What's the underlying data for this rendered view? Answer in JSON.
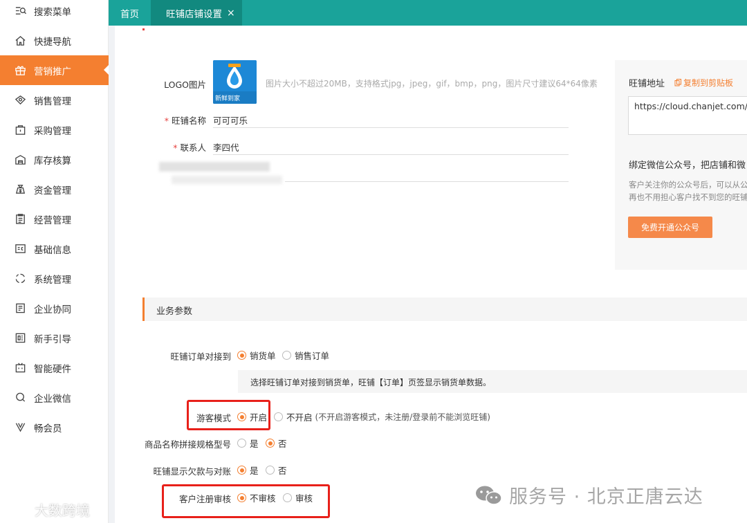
{
  "sidebar": {
    "items": [
      {
        "label": "搜索菜单",
        "icon": "search-menu-icon"
      },
      {
        "label": "快捷导航",
        "icon": "home-icon"
      },
      {
        "label": "营销推广",
        "icon": "gift-icon",
        "active": true
      },
      {
        "label": "销售管理",
        "icon": "sales-icon"
      },
      {
        "label": "采购管理",
        "icon": "bag-icon"
      },
      {
        "label": "库存核算",
        "icon": "warehouse-icon"
      },
      {
        "label": "资金管理",
        "icon": "money-bag-icon"
      },
      {
        "label": "经营管理",
        "icon": "clipboard-icon"
      },
      {
        "label": "基础信息",
        "icon": "id-card-icon"
      },
      {
        "label": "系统管理",
        "icon": "loading-circle-icon"
      },
      {
        "label": "企业协同",
        "icon": "document-icon"
      },
      {
        "label": "新手引导",
        "icon": "guide-icon"
      },
      {
        "label": "智能硬件",
        "icon": "device-icon"
      },
      {
        "label": "企业微信",
        "icon": "wechat-work-icon"
      },
      {
        "label": "畅会员",
        "icon": "v-icon"
      }
    ]
  },
  "tabs": [
    {
      "label": "首页",
      "active": false
    },
    {
      "label": "旺铺店铺设置",
      "active": true,
      "close": "×"
    }
  ],
  "form": {
    "logo_label": "LOGO图片",
    "logo_text": "新鲜到家",
    "logo_hint": "图片大小不超过20MB，支持格式jpg，jpeg，gif，bmp，png，图片尺寸建议64*64像素",
    "shop_name_label": "旺铺名称",
    "shop_name_value": "可可可乐",
    "contact_label": "联系人",
    "contact_value": "李四代",
    "required_mark": "*"
  },
  "panel": {
    "title": "旺铺地址",
    "copy_link": "复制到剪贴板",
    "url": "https://cloud.chanjet.com/hs",
    "bind_title": "绑定微信公众号，把店铺和微",
    "bind_desc_1": "客户关注你的公众号后，可以从公",
    "bind_desc_2": "再也不用担心客户找不到您的旺铺",
    "button": "免费开通公众号"
  },
  "section": {
    "title": "业务参数"
  },
  "params": {
    "order_label": "旺铺订单对接到",
    "order_opt1": "销货单",
    "order_opt2": "销售订单",
    "order_info": "选择旺铺订单对接到销货单，旺铺【订单】页签显示销货单数据。",
    "guest_label": "游客模式",
    "guest_opt1": "开启",
    "guest_opt2": "不开启",
    "guest_note": "(不开启游客模式，未注册/登录前不能浏览旺铺)",
    "spec_label": "商品名称拼接规格型号",
    "spec_opt1": "是",
    "spec_opt2": "否",
    "debt_label": "旺铺显示欠款与对账",
    "debt_opt1": "是",
    "debt_opt2": "否",
    "audit_label": "客户注册审核",
    "audit_opt1": "不审核",
    "audit_opt2": "审核"
  },
  "watermarks": {
    "left": "大数跨境",
    "right": "服务号 · 北京正唐云达"
  },
  "colors": {
    "accent": "#f47f30",
    "topbar": "#1aa39a",
    "highlight_box": "#e8201a"
  }
}
